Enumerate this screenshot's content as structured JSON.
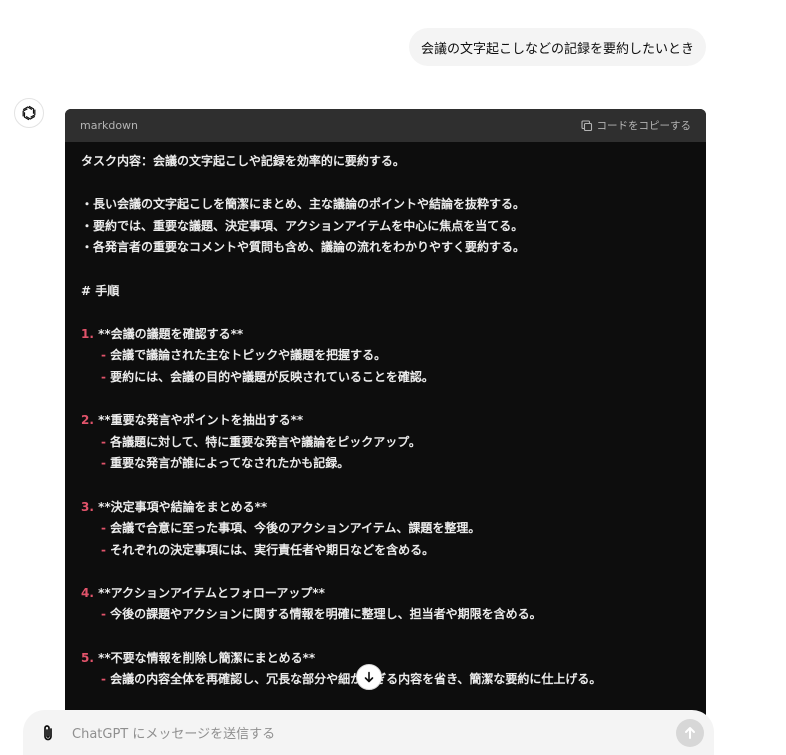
{
  "user_message": "会議の文字起こしなどの記録を要約したいとき",
  "assistant_avatar_icon": "openai-logo-icon",
  "code_block": {
    "language": "markdown",
    "copy_label": "コードをコピーする",
    "lines": {
      "l1": "タスク内容：会議の文字起こしや記録を効率的に要約する。",
      "l2": "・長い会議の文字起こしを簡潔にまとめ、主な議論のポイントや結論を抜粋する。",
      "l3": "・要約では、重要な議題、決定事項、アクションアイテムを中心に焦点を当てる。",
      "l4": "・各発言者の重要なコメントや質問も含め、議論の流れをわかりやすく要約する。",
      "l5": "# 手順",
      "s1": {
        "num": "1.",
        "title": "**会議の議題を確認する**",
        "b1": "会議で議論された主なトピックや議題を把握する。",
        "b2": "要約には、会議の目的や議題が反映されていることを確認。"
      },
      "s2": {
        "num": "2.",
        "title": "**重要な発言やポイントを抽出する**",
        "b1": "各議題に対して、特に重要な発言や議論をピックアップ。",
        "b2": "重要な発言が誰によってなされたかも記録。"
      },
      "s3": {
        "num": "3.",
        "title": "**決定事項や結論をまとめる**",
        "b1": "会議で合意に至った事項、今後のアクションアイテム、課題を整理。",
        "b2": "それぞれの決定事項には、実行責任者や期日などを含める。"
      },
      "s4": {
        "num": "4.",
        "title": "**アクションアイテムとフォローアップ**",
        "b1": "今後の課題やアクションに関する情報を明確に整理し、担当者や期限を含める。"
      },
      "s5": {
        "num": "5.",
        "title": "**不要な情報を削除し簡潔にまとめる**",
        "b1": "会議の内容全体を再確認し、冗長な部分や細かすぎる内容を省き、簡潔な要約に仕上げる。"
      }
    },
    "dash": "-"
  },
  "composer": {
    "placeholder": "ChatGPT にメッセージを送信する",
    "attach_icon": "paperclip-icon",
    "send_icon": "arrow-up-icon"
  },
  "scroll_down_icon": "arrow-down-icon"
}
